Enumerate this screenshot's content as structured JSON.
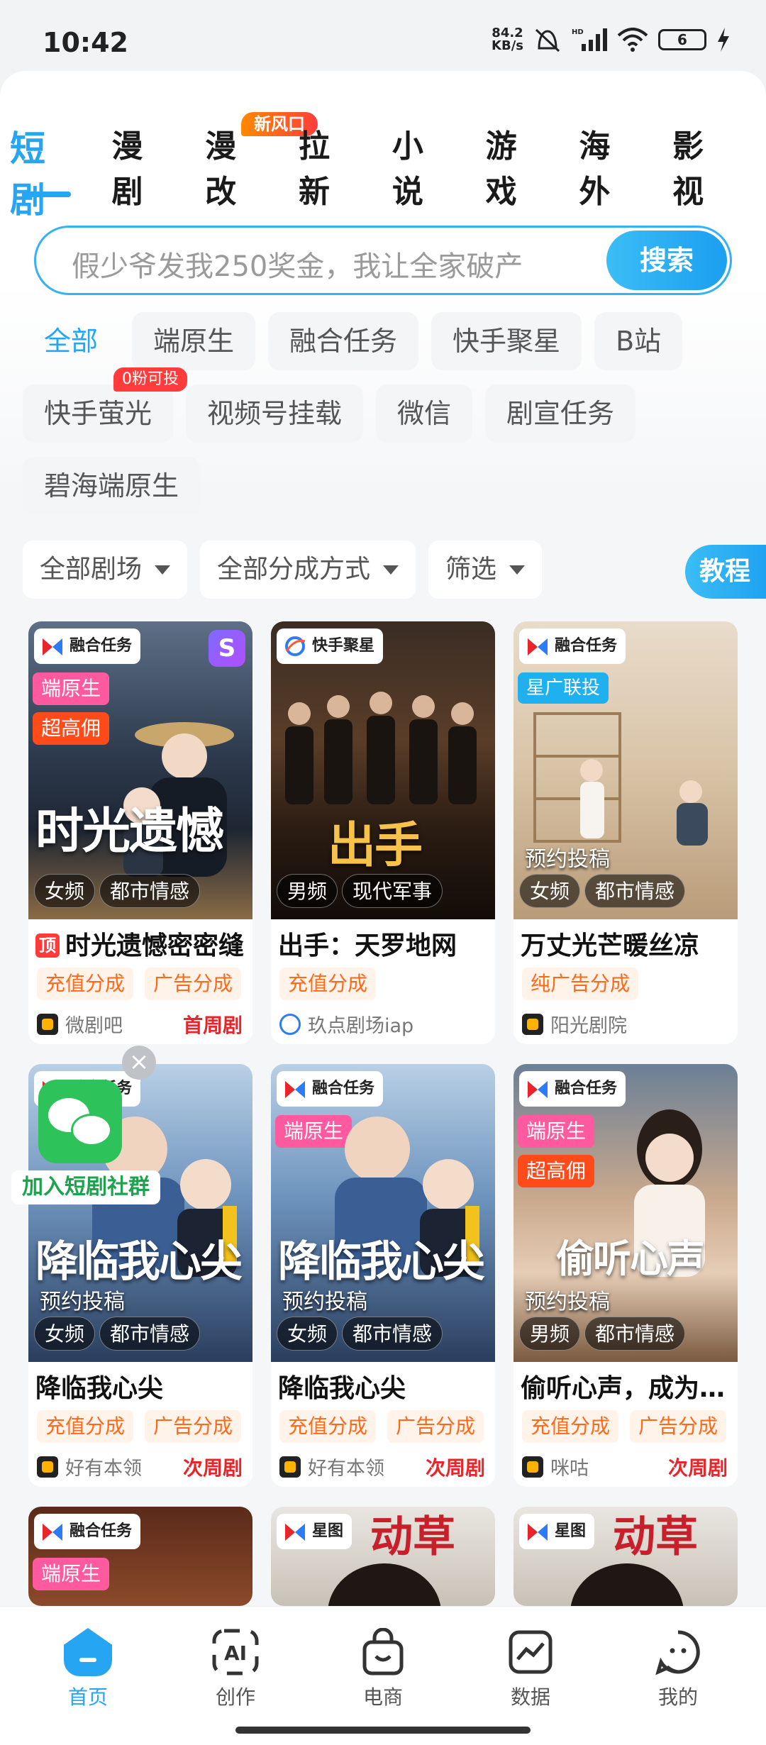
{
  "status_bar": {
    "time": "10:42",
    "speed_value": "84.2",
    "speed_unit": "KB/s",
    "battery": "6"
  },
  "top_tabs": [
    "短剧",
    "漫剧",
    "漫改",
    "拉新",
    "小说",
    "游戏",
    "海外",
    "影视"
  ],
  "top_tabs_badge": "新风口",
  "search": {
    "placeholder": "假少爷发我250奖金，我让全家破产",
    "button": "搜索"
  },
  "categories": {
    "row1": [
      "全部",
      "端原生",
      "融合任务",
      "快手聚星",
      "B站"
    ],
    "row2": [
      "快手萤光",
      "视频号挂载",
      "微信",
      "剧宣任务"
    ],
    "row3": [
      "碧海端原生"
    ],
    "badge_0fan": "0粉可投"
  },
  "filters": [
    "全部剧场",
    "全部分成方式",
    "筛选"
  ],
  "tutorial": "教程",
  "cards": [
    {
      "task": "融合任务",
      "tags": [
        "端原生",
        "超高佣"
      ],
      "art": "时光遗憾",
      "genres": [
        "女频",
        "都市情感"
      ],
      "ding": "顶",
      "title": "时光遗憾密密缝",
      "pay": [
        "充值分成",
        "广告分成"
      ],
      "source": "微剧吧",
      "right": "首周剧",
      "s_icon": "S"
    },
    {
      "task": "快手聚星",
      "art": "出手",
      "genres": [
        "男频",
        "现代军事"
      ],
      "title": "出手：天罗地网",
      "pay": [
        "充值分成"
      ],
      "source": "玖点剧场iap"
    },
    {
      "task": "融合任务",
      "tags": [
        "星广联投"
      ],
      "pre": "预约投稿",
      "genres": [
        "女频",
        "都市情感"
      ],
      "title": "万丈光芒暖丝凉",
      "pay": [
        "纯广告分成"
      ],
      "source": "阳光剧院"
    },
    {
      "task": "融合任务",
      "pre": "预约投稿",
      "art": "降临我心尖",
      "genres": [
        "女频",
        "都市情感"
      ],
      "title": "降临我心尖",
      "pay": [
        "充值分成",
        "广告分成"
      ],
      "source": "好有本领",
      "right": "次周剧"
    },
    {
      "task": "融合任务",
      "tags": [
        "端原生"
      ],
      "pre": "预约投稿",
      "art": "降临我心尖",
      "genres": [
        "女频",
        "都市情感"
      ],
      "title": "降临我心尖",
      "pay": [
        "充值分成",
        "广告分成"
      ],
      "source": "好有本领",
      "right": "次周剧"
    },
    {
      "task": "融合任务",
      "tags": [
        "端原生",
        "超高佣"
      ],
      "pre": "预约投稿",
      "genres": [
        "男频",
        "都市情感"
      ],
      "title": "偷听心声，成为…",
      "pay": [
        "充值分成",
        "广告分成"
      ],
      "source": "咪咕",
      "right": "次周剧"
    },
    {
      "task": "融合任务",
      "tags": [
        "端原生"
      ]
    },
    {
      "task": "星图",
      "art": "动草"
    },
    {
      "task": "星图",
      "art": "动草"
    }
  ],
  "wechat_float": {
    "label": "加入短剧社群",
    "close": "×"
  },
  "bottom_nav": [
    "首页",
    "创作",
    "电商",
    "数据",
    "我的"
  ],
  "colors": {
    "accent": "#26a6f2",
    "pink_tag": "#ff5aa0",
    "red_tag": "#ff4a1a",
    "pay_tag_text": "#ff6a1a"
  }
}
